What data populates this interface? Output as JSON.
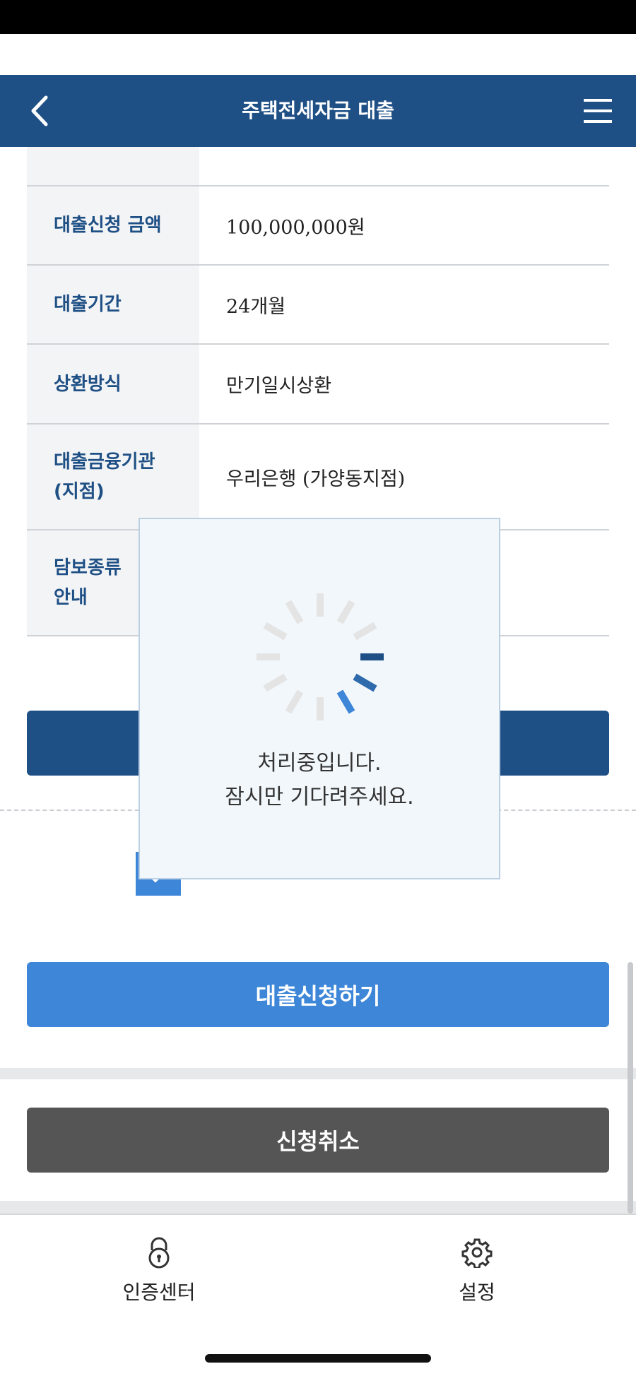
{
  "header": {
    "title": "주택전세자금 대출",
    "back_icon": "chevron-left-icon",
    "menu_icon": "hamburger-menu-icon"
  },
  "info_table": [
    {
      "label": "대출신청 금액",
      "value": "100,000,000원"
    },
    {
      "label": "대출기간",
      "value": "24개월"
    },
    {
      "label": "상환방식",
      "value": "만기일시상환"
    },
    {
      "label": "대출금융기관\n(지점)",
      "value": "우리은행 (가양동지점)"
    },
    {
      "label": "담보종류\n안내",
      "value": ""
    }
  ],
  "actions": {
    "apply_label": "대출신청하기",
    "cancel_label": "신청취소"
  },
  "loading": {
    "line1": "처리중입니다.",
    "line2": "잠시만 기다려주세요."
  },
  "tabbar": {
    "auth_label": "인증센터",
    "auth_icon": "lock-icon",
    "settings_label": "설정",
    "settings_icon": "gear-icon"
  },
  "colors": {
    "primary": "#1e4f85",
    "accent": "#3d86d8",
    "cancel": "#555555"
  }
}
